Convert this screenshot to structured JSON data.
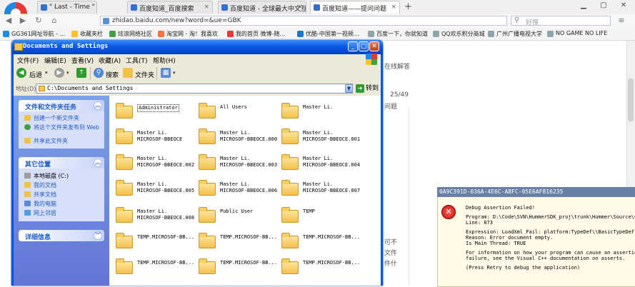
{
  "browser": {
    "tabs": [
      {
        "label": "\" Last - Time \" [http:",
        "active": false
      },
      {
        "label": "百度知道_百度搜索",
        "active": false
      },
      {
        "label": "百度知道 - 全球最大中文互",
        "active": false
      },
      {
        "label": "百度知道——提问问题",
        "active": true
      }
    ],
    "url": "zhidao.baidu.com/new?word=&ue=GBK",
    "search_placeholder": "好搜",
    "bookmarks": [
      "GG361网址导航 - ...",
      "收藏夹栏",
      "炫浪网络社区",
      "淘宝网 - 淘！我喜欢",
      "我的首页 微博-随...",
      "优酷-中国第一视频...",
      "百度一下，你就知道",
      "QQ欢乐积分商城",
      "广州广播电视大学",
      "NO GAME NO LIFE"
    ],
    "background_texts": [
      "在线解答",
      "25/49",
      "问题",
      "可不",
      "文件",
      "件什"
    ]
  },
  "explorer": {
    "title": "Documents and Settings",
    "menu": [
      "文件(F)",
      "编辑(E)",
      "查看(V)",
      "收藏(A)",
      "工具(T)",
      "帮助(H)"
    ],
    "toolbar": {
      "back": "后退",
      "search": "搜索",
      "folders": "文件夹"
    },
    "address_label": "地址(D)",
    "address": "C:\\Documents and Settings",
    "go": "转到",
    "tasks_panel": {
      "title": "文件和文件夹任务",
      "items": [
        "创建一个新文件夹",
        "将这个文件夹发布到 Web",
        "共享此文件夹"
      ]
    },
    "places_panel": {
      "title": "其它位置",
      "items": [
        "本地磁盘 (C:)",
        "我的文档",
        "共享文档",
        "我的电脑",
        "网上邻居"
      ]
    },
    "details_panel": {
      "title": "详细信息"
    },
    "folders": [
      {
        "name": "Administrator",
        "selected": true
      },
      {
        "name": "All Users"
      },
      {
        "name": "Master Li."
      },
      {
        "name": "Master Li.\nMICROSOF-BBEOCE"
      },
      {
        "name": "Master Li.\nMICROSOF-BBEOCE.000"
      },
      {
        "name": "Master Li.\nMICROSOF-BBEOCE.001"
      },
      {
        "name": "Master Li.\nMICROSOF-BBEOCE.002"
      },
      {
        "name": "Master Li.\nMICROSOF-BBEOCE.003"
      },
      {
        "name": "Master Li.\nMICROSOF-BBEOCE.004"
      },
      {
        "name": "Master Li.\nMICROSOF-BBEOCE.005"
      },
      {
        "name": "Master Li.\nMICROSOF-BBEOCE.006"
      },
      {
        "name": "Master Li.\nMICROSOF-BBEOCE.007"
      },
      {
        "name": "Master Li.\nMICROSOF-BBEOCE.008"
      },
      {
        "name": "Public User"
      },
      {
        "name": "TEMP"
      },
      {
        "name": "TEMP.MICROSOF-BB..."
      },
      {
        "name": "TEMP.MICROSOF-BB..."
      },
      {
        "name": "TEMP.MICROSOF-BB..."
      },
      {
        "name": "TEMP.MICROSOF-BB..."
      },
      {
        "name": "TEMP.MICROSOF-BB..."
      },
      {
        "name": "TEMP.MICROSOF-BB..."
      }
    ]
  },
  "debug_dialog": {
    "title": "0A9C391D-036A-4E6C-ABFC-05E6AF816235",
    "lines": [
      "Debug Assertion Failed!",
      "",
      "Program: D:\\Code\\SVN\\HummerSDK_proj\\trunk\\Hummer\\Source\\Comm",
      "Line: 873",
      "",
      "Expression: LoadXml Fail: platform:TypeDef\\\\BasicTypeDef.xml,",
      "Reason: Error document empty.",
      "Is Main Thread: TRUE",
      "",
      "For information on how your program can cause an assertion",
      "failure, see the Visual C++ documentation on asserts.",
      "",
      "(Press Retry to debug the application)"
    ]
  },
  "colors": {
    "xp_blue": "#0054e3",
    "xp_panel": "#d6dff7",
    "dialog_bg": "#fffbe8",
    "error_red": "#c41111"
  }
}
